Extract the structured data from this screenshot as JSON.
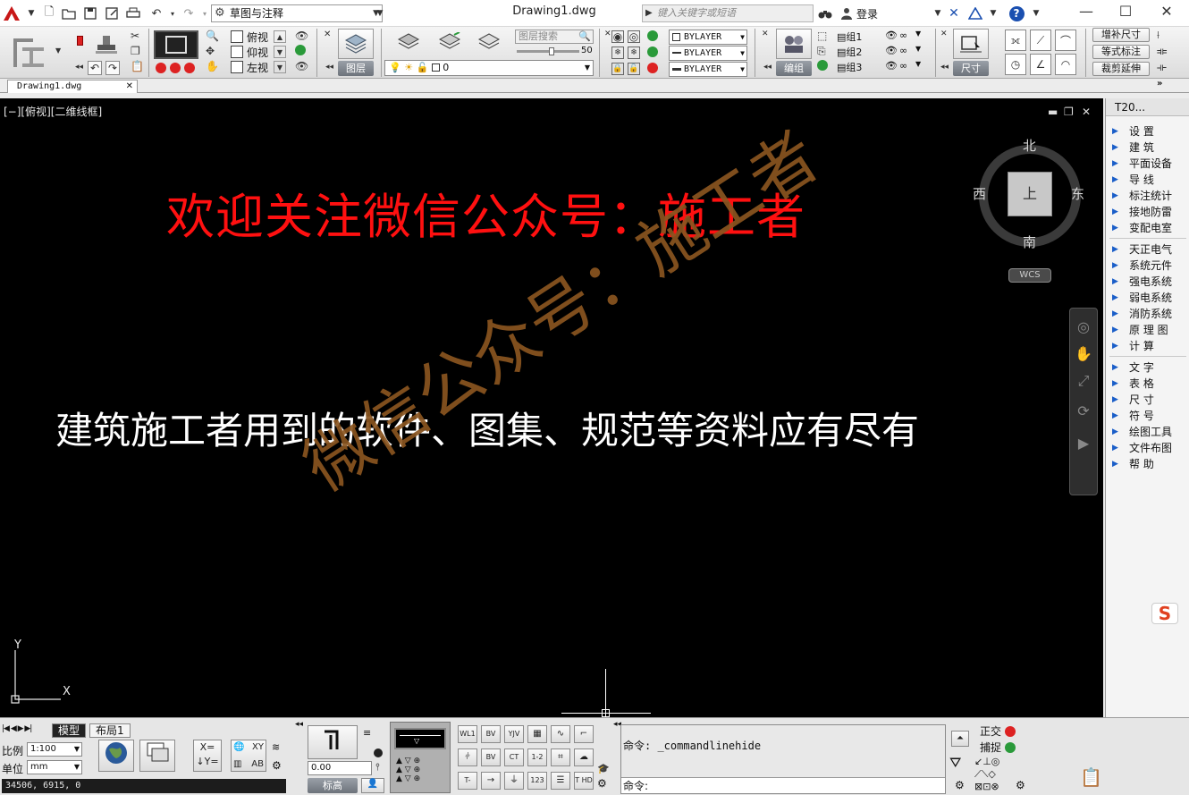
{
  "app": {
    "workspace": "草图与注释",
    "doc_title": "Drawing1.dwg",
    "search_placeholder": "键入关键字或短语",
    "login": "登录"
  },
  "ribbon": {
    "views": [
      "俯视",
      "仰视",
      "左视"
    ],
    "layer_panel_label": "图层",
    "layer_search_placeholder": "图层搜索",
    "layer_slider_value": "50",
    "current_layer": "0",
    "bylayer": [
      "BYLAYER",
      "BYLAYER",
      "BYLAYER"
    ],
    "groups": [
      "组1",
      "组2",
      "组3"
    ],
    "group_panel_label": "编组",
    "dim_panel_label": "尺寸",
    "right_buttons": [
      "增补尺寸",
      "等式标注",
      "裁剪延伸"
    ]
  },
  "tabs": {
    "doc_tab": "Drawing1.dwg"
  },
  "canvas": {
    "view_label": "[−][俯视][二维线框]",
    "headline": "欢迎关注微信公众号：施工者",
    "subline": "建筑施工者用到的软件、图集、规范等资料应有尽有",
    "watermark": "微信公众号：施工者",
    "viewcube": {
      "north": "北",
      "south": "南",
      "east": "东",
      "west": "西",
      "face": "上",
      "wcs": "WCS"
    },
    "ucs": {
      "x": "X",
      "y": "Y"
    }
  },
  "t20": {
    "title": "T20...",
    "groups": [
      [
        "设    置",
        "建    筑",
        "平面设备",
        "导    线",
        "标注统计",
        "接地防雷",
        "变配电室"
      ],
      [
        "天正电气",
        "系统元件",
        "强电系统",
        "弱电系统",
        "消防系统",
        "原 理 图",
        "计    算"
      ],
      [
        "文    字",
        "表    格",
        "尺    寸",
        "符    号",
        "绘图工具",
        "文件布图",
        "帮    助"
      ]
    ]
  },
  "bottom": {
    "layout_tabs": [
      "模型",
      "布局1"
    ],
    "scale_label": "比例",
    "scale_value": "1:100",
    "unit_label": "单位",
    "unit_value": "mm",
    "coords": "34506, 6915, 0",
    "elev_value": "0.00",
    "elev_label": "标高",
    "cmd_history": "命令: _commandlinehide",
    "cmd_prompt": "命令:",
    "ortho": "正交",
    "snap": "捕捉",
    "sym_labels": [
      "WL1",
      "BV",
      "YJV",
      "BV",
      "CT",
      "1-2",
      "T-",
      "T HD",
      "123"
    ]
  },
  "colors": {
    "canvas_bg": "#000000",
    "headline": "#ff1010",
    "watermark": "#8a5520",
    "accent_blue": "#1a5ec8"
  }
}
